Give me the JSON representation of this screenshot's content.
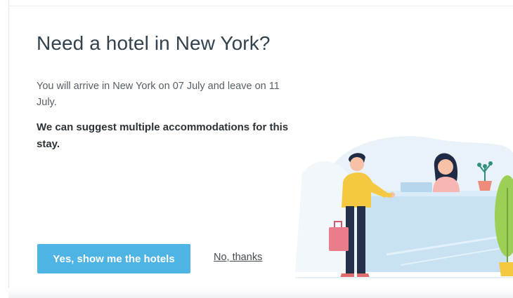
{
  "dialog": {
    "title": "Need a hotel in New York?",
    "description": "You will arrive in New York on 07 July and leave on 11 July.",
    "suggestion": "We can suggest multiple accommodations for this stay.",
    "primary_button": "Yes, show me the hotels",
    "secondary_link": "No, thanks"
  },
  "illustration": {
    "name": "hotel-reception-illustration",
    "colors": {
      "desk": "#c8e2f3",
      "backdrop": "#e9f2f9",
      "shirt": "#f5c842",
      "pants": "#25314a",
      "suitcase": "#e97d8c",
      "receptionist_shirt": "#f7b6b2",
      "plant": "#9bcf55",
      "pot": "#ef8c79"
    }
  },
  "theme": {
    "primary": "#4db4e3",
    "title_color": "#33424d"
  }
}
